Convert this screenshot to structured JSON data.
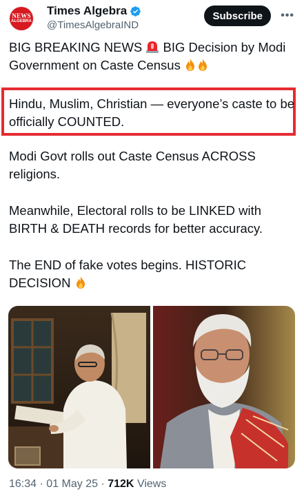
{
  "account": {
    "avatar_line1": "NEWS",
    "avatar_line2": "ALGEBRA",
    "display_name": "Times Algebra",
    "handle": "@TimesAlgebraIND",
    "verified_icon": "verified-badge-icon",
    "verified_color": "#1d9bf0"
  },
  "header": {
    "subscribe_label": "Subscribe",
    "more_icon": "more-options-icon"
  },
  "tweet": {
    "p1_a": "BIG BREAKING NEWS ",
    "p1_b": " BIG Decision by Modi Government on Caste Census ",
    "p2": "Hindu, Muslim, Christian — everyone’s caste to be officially COUNTED.",
    "p3": "Modi Govt rolls out Caste Census ACROSS religions.",
    "p4": "Meanwhile, Electoral rolls to be LINKED with BIRTH & DEATH records for better accuracy.",
    "p5": "The END of fake votes begins. HISTORIC DECISION ",
    "emoji": [
      "siren-emoji",
      "fire-emoji"
    ],
    "highlight_color": "#e52b32"
  },
  "media": {
    "images": [
      {
        "name": "photo-man-reading-at-desk"
      },
      {
        "name": "photo-man-with-white-beard-and-red-shawl"
      }
    ]
  },
  "meta": {
    "time": "16:34",
    "date": "01 May 25",
    "views_count": "712K",
    "views_label": "Views"
  }
}
